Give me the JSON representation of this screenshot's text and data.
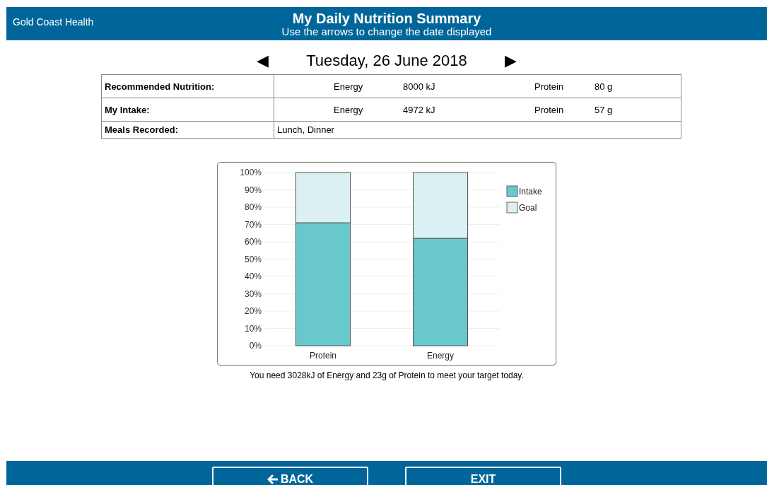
{
  "header": {
    "brand": "Gold Coast Health",
    "title": "My Daily Nutrition Summary",
    "subtitle": "Use the arrows to change the date displayed"
  },
  "date_nav": {
    "prev": "◀",
    "date": "Tuesday, 26 June 2018",
    "next": "▶"
  },
  "table": {
    "rows": [
      {
        "kind": "nutrients",
        "label": "Recommended Nutrition:",
        "items": [
          {
            "name": "Energy",
            "value": "8000 kJ"
          },
          {
            "name": "Protein",
            "value": "80 g"
          }
        ]
      },
      {
        "kind": "nutrients",
        "label": "My Intake:",
        "items": [
          {
            "name": "Energy",
            "value": "4972 kJ"
          },
          {
            "name": "Protein",
            "value": "57 g"
          }
        ]
      },
      {
        "kind": "text",
        "label": "Meals Recorded:",
        "value": "Lunch, Dinner"
      }
    ]
  },
  "chart": {
    "chart_data": {
      "type": "bar",
      "stacked": true,
      "categories": [
        "Protein",
        "Energy"
      ],
      "series": [
        {
          "name": "Intake",
          "color": "#68c8cd",
          "values": [
            71,
            62
          ]
        },
        {
          "name": "Goal",
          "color": "#daf0f2",
          "values": [
            29,
            38
          ]
        }
      ],
      "ylim": [
        0,
        100
      ],
      "grid": true,
      "legend": true,
      "yticks": [
        {
          "value": 0,
          "label": "0%"
        },
        {
          "value": 10,
          "label": "10%"
        },
        {
          "value": 20,
          "label": "20%"
        },
        {
          "value": 30,
          "label": "30%"
        },
        {
          "value": 40,
          "label": "40%"
        },
        {
          "value": 50,
          "label": "50%"
        },
        {
          "value": 60,
          "label": "60%"
        },
        {
          "value": 70,
          "label": "70%"
        },
        {
          "value": 80,
          "label": "80%"
        },
        {
          "value": 90,
          "label": "90%"
        },
        {
          "value": 100,
          "label": "100%"
        }
      ]
    },
    "note": "You need 3028kJ of Energy and 23g of Protein to meet your target today."
  },
  "footer": {
    "buttons": [
      {
        "kind": "back",
        "label": "BACK"
      },
      {
        "kind": "exit",
        "label": "EXIT"
      }
    ]
  }
}
